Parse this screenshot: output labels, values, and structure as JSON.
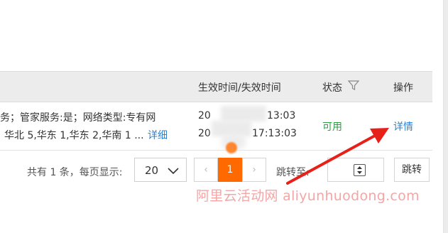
{
  "table": {
    "headers": {
      "effective_time": "生效时间/失效时间",
      "status": "状态",
      "operation": "操作"
    },
    "row": {
      "attrs_line1": "务；管家服务:是；网络类型:专有网",
      "attrs_line2": "华北 5,华东 1,华东 2,华南 1 ...",
      "attrs_detail": "详细",
      "start_time_prefix": "20",
      "start_time_suffix": "13:03",
      "end_time_prefix": "20",
      "end_time_suffix": "17:13:03",
      "status": "可用",
      "detail_link": "详情"
    }
  },
  "pagination": {
    "total_text": "共有 1 条，每页显示:",
    "page_size": "20",
    "prev_label": "‹",
    "current_page": "1",
    "next_label": "›",
    "jump_label": "跳转至:",
    "jump_button": "跳转"
  },
  "watermark": "阿里云活动网  aliyunhuodong.com",
  "colors": {
    "accent": "#ff6a00",
    "link": "#2a82d5",
    "status_ok": "#2a9e41",
    "annotation_arrow": "#e8201a"
  },
  "icons": {
    "filter": "filter-icon",
    "select_chevron": "chevron-down-icon",
    "stepper": "spinner-icon"
  }
}
